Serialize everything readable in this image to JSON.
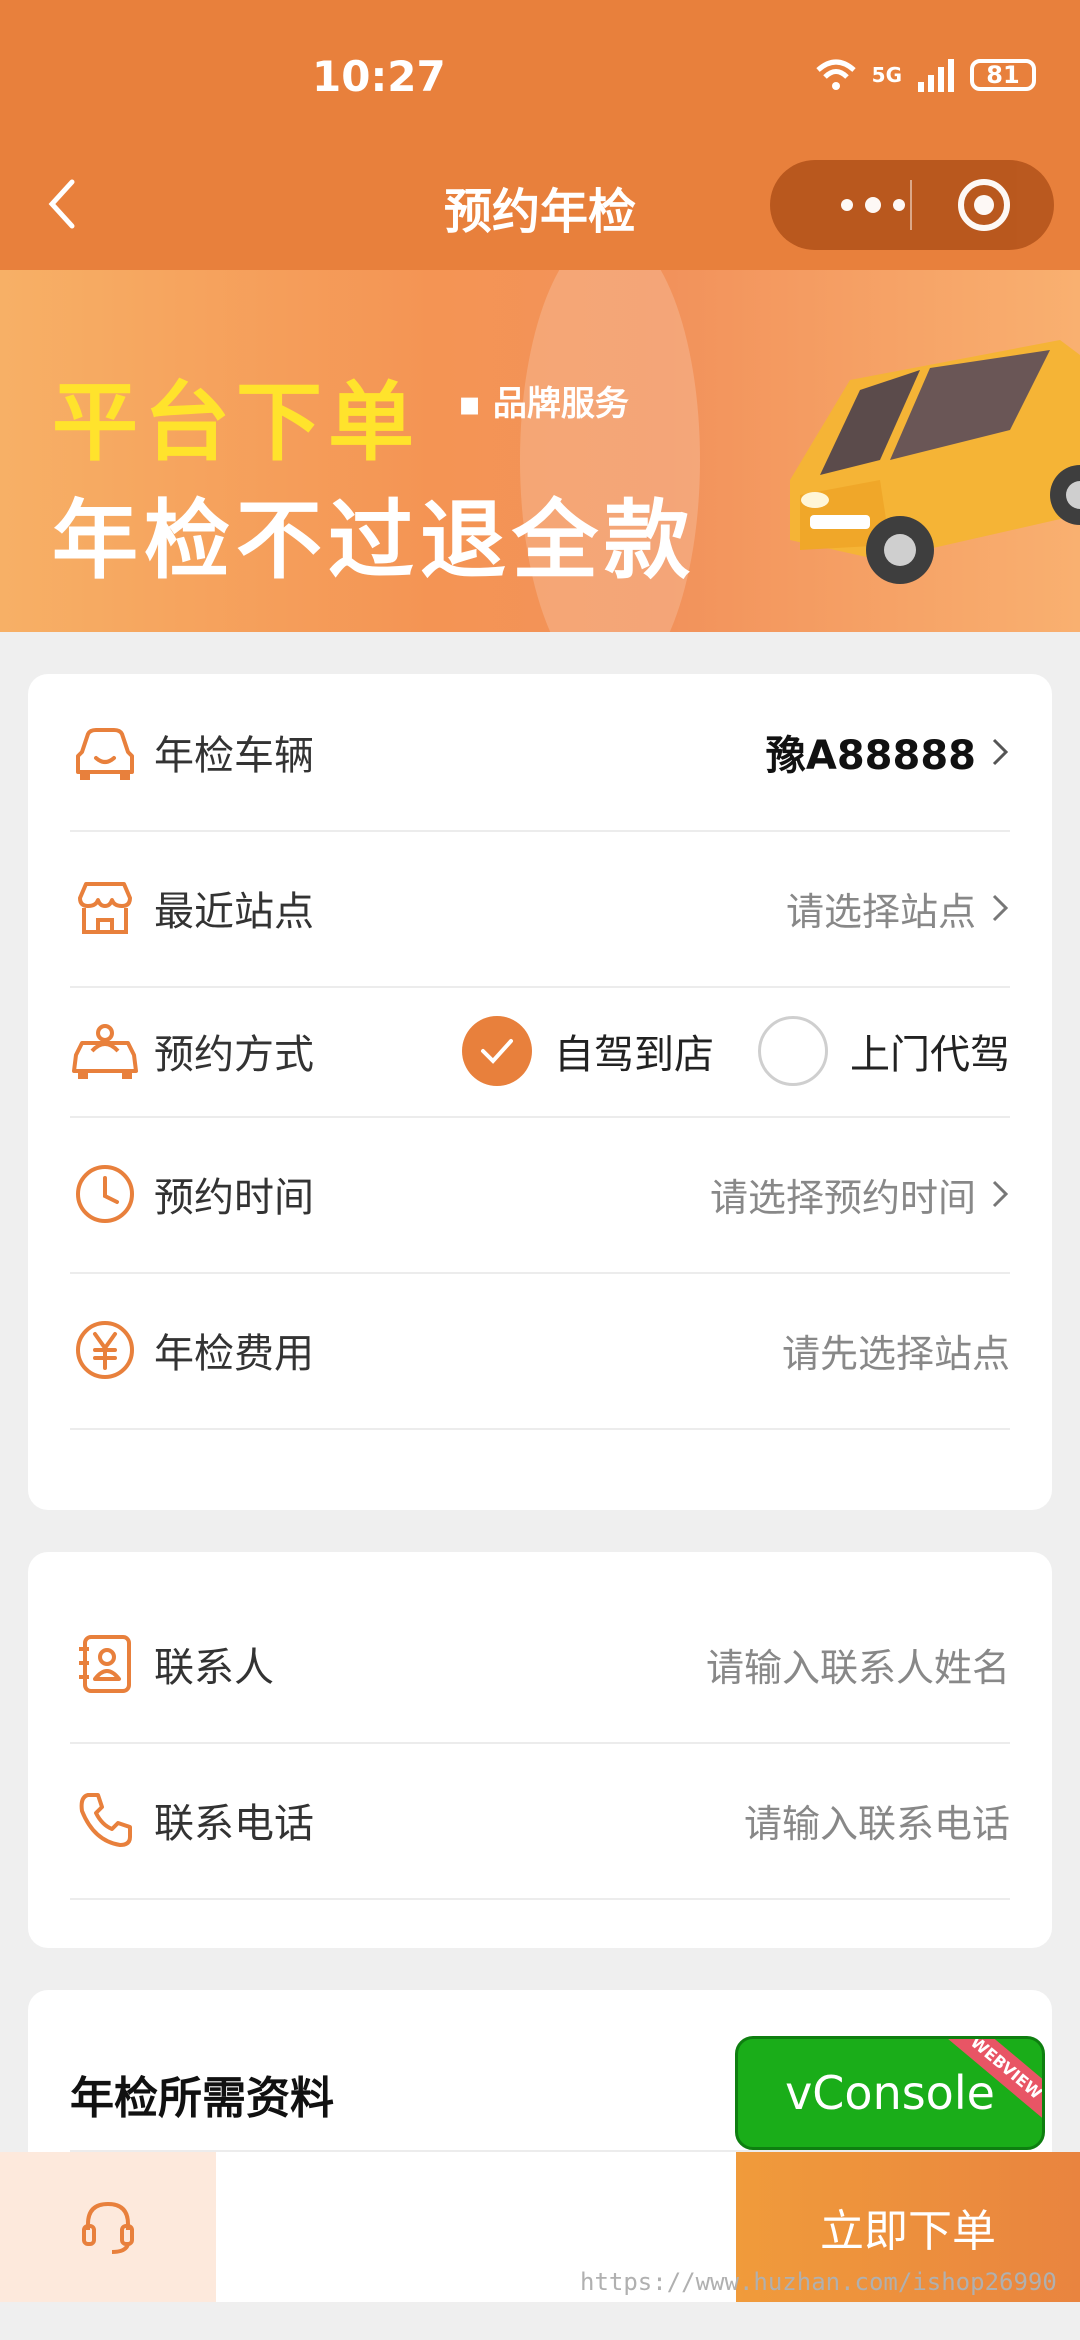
{
  "status_bar": {
    "time": "10:27",
    "network": "5G",
    "battery": "81"
  },
  "nav": {
    "title": "预约年检"
  },
  "banner": {
    "line1": "平台下单",
    "service": "▪ 品牌服务",
    "line2": "年检不过退全款"
  },
  "form": {
    "vehicle": {
      "label": "年检车辆",
      "value": "豫A88888"
    },
    "station": {
      "label": "最近站点",
      "value": "请选择站点"
    },
    "method": {
      "label": "预约方式",
      "options": [
        "自驾到店",
        "上门代驾"
      ],
      "selected": "自驾到店"
    },
    "time": {
      "label": "预约时间",
      "value": "请选择预约时间"
    },
    "fee": {
      "label": "年检费用",
      "value": "请先选择站点"
    }
  },
  "contact": {
    "name": {
      "label": "联系人",
      "placeholder": "请输入联系人姓名"
    },
    "phone": {
      "label": "联系电话",
      "placeholder": "请输入联系电话"
    }
  },
  "materials": {
    "title": "年检所需资料"
  },
  "vconsole": {
    "label": "vConsole",
    "ribbon": "WEBVIEW"
  },
  "bottom": {
    "order_label": "立即下单"
  },
  "watermark": "https://www.huzhan.com/ishop26990",
  "colors": {
    "accent": "#e8803c",
    "vconsole": "#1aad19"
  }
}
